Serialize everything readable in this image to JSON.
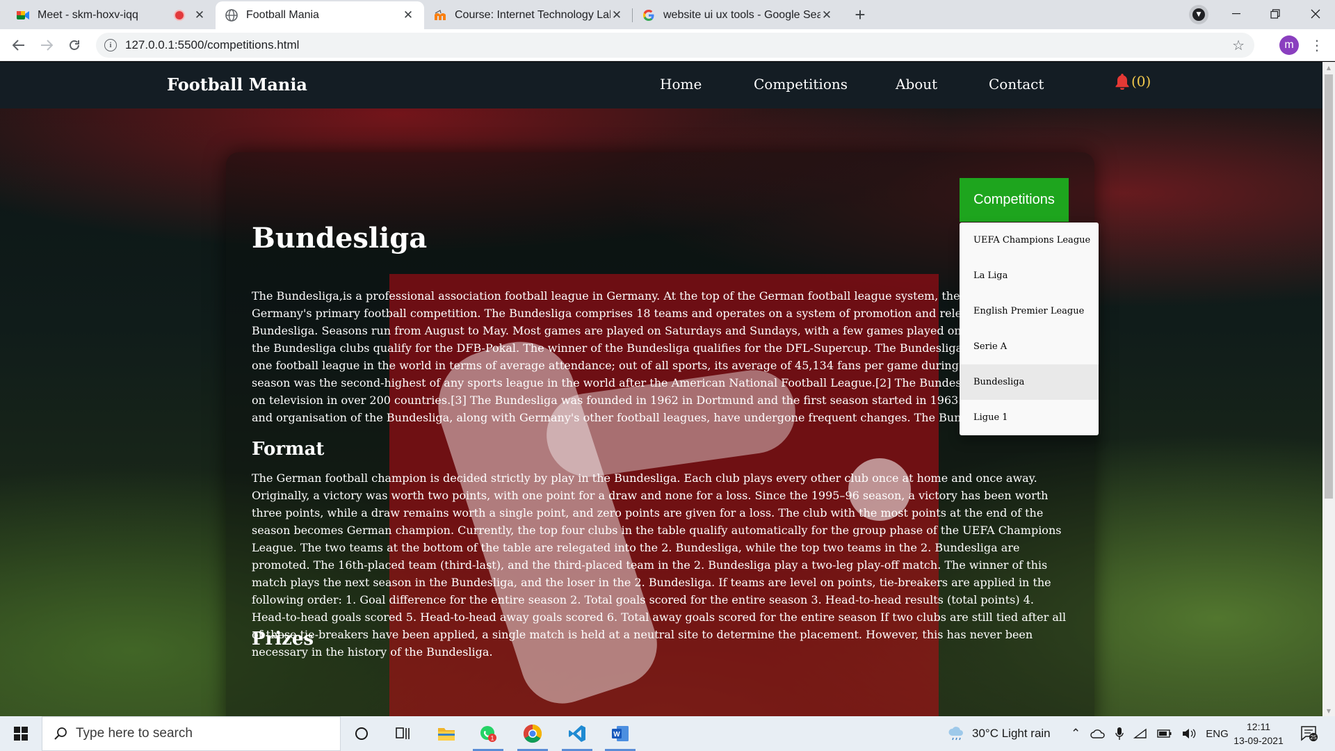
{
  "browser": {
    "tabs": [
      {
        "title": "Meet - skm-hoxv-iqq",
        "icon": "google-meet-icon",
        "recording": true
      },
      {
        "title": "Football Mania",
        "icon": "globe-icon",
        "active": true
      },
      {
        "title": "Course: Internet Technology Lab",
        "icon": "moodle-icon"
      },
      {
        "title": "website ui ux tools - Google Sear",
        "icon": "google-icon"
      }
    ],
    "url": "127.0.0.1:5500/competitions.html",
    "profile_initial": "m"
  },
  "site": {
    "brand": "Football Mania",
    "nav": [
      "Home",
      "Competitions",
      "About",
      "Contact"
    ],
    "notification_count": "(0)",
    "bell_color": "#e53935"
  },
  "dropdown": {
    "button_label": "Competitions",
    "items": [
      "UEFA Champions League",
      "La Liga",
      "English Premier League",
      "Serie A",
      "Bundesliga",
      "Ligue 1"
    ],
    "highlighted": "Bundesliga"
  },
  "article": {
    "title": "Bundesliga",
    "intro": "The Bundesliga,is a professional association football league in Germany. At the top of the German football league system, the Bundesliga is Germany's primary football competition. The Bundesliga comprises 18 teams and operates on a system of promotion and relegation with the 2. Bundesliga. Seasons run from August to May. Most games are played on Saturdays and Sundays, with a few games played on weekdays. All of the Bundesliga clubs qualify for the DFB-Pokal. The winner of the Bundesliga qualifies for the DFL-Supercup. The Bundesliga is the number one football league in the world in terms of average attendance; out of all sports, its average of 45,134 fans per game during the 2011–12 season was the second-highest of any sports league in the world after the American National Football League.[2] The Bundesliga is broadcast on television in over 200 countries.[3] The Bundesliga was founded in 1962 in Dortmund and the first season started in 1963. The structure and organisation of the Bundesliga, along with Germany's other football leagues, have undergone frequent changes. The Bundesliga was founded by the Deutscher Fußball-Bund (English: German Football Association), but is now operated by the Deutsche Fußball Liga (English: German Football League).",
    "format_heading": "Format",
    "format_text": "The German football champion is decided strictly by play in the Bundesliga. Each club plays every other club once at home and once away. Originally, a victory was worth two points, with one point for a draw and none for a loss. Since the 1995–96 season, a victory has been worth three points, while a draw remains worth a single point, and zero points are given for a loss. The club with the most points at the end of the season becomes German champion. Currently, the top four clubs in the table qualify automatically for the group phase of the UEFA Champions League. The two teams at the bottom of the table are relegated into the 2. Bundesliga, while the top two teams in the 2. Bundesliga are promoted. The 16th-placed team (third-last), and the third-placed team in the 2. Bundesliga play a two-leg play-off match. The winner of this match plays the next season in the Bundesliga, and the loser in the 2. Bundesliga. If teams are level on points, tie-breakers are applied in the following order: 1. Goal difference for the entire season 2. Total goals scored for the entire season 3. Head-to-head results (total points) 4. Head-to-head goals scored 5. Head-to-head away goals scored 6. Total away goals scored for the entire season If two clubs are still tied after all of these tie-breakers have been applied, a single match is held at a neutral site to determine the placement. However, this has never been necessary in the history of the Bundesliga.",
    "prizes_heading": "Prizes"
  },
  "taskbar": {
    "search_placeholder": "Type here to search",
    "weather": "30°C  Light rain",
    "language": "ENG",
    "time": "12:11",
    "date": "13-09-2021",
    "notification_badge": "25",
    "whatsapp_badge": "1"
  }
}
